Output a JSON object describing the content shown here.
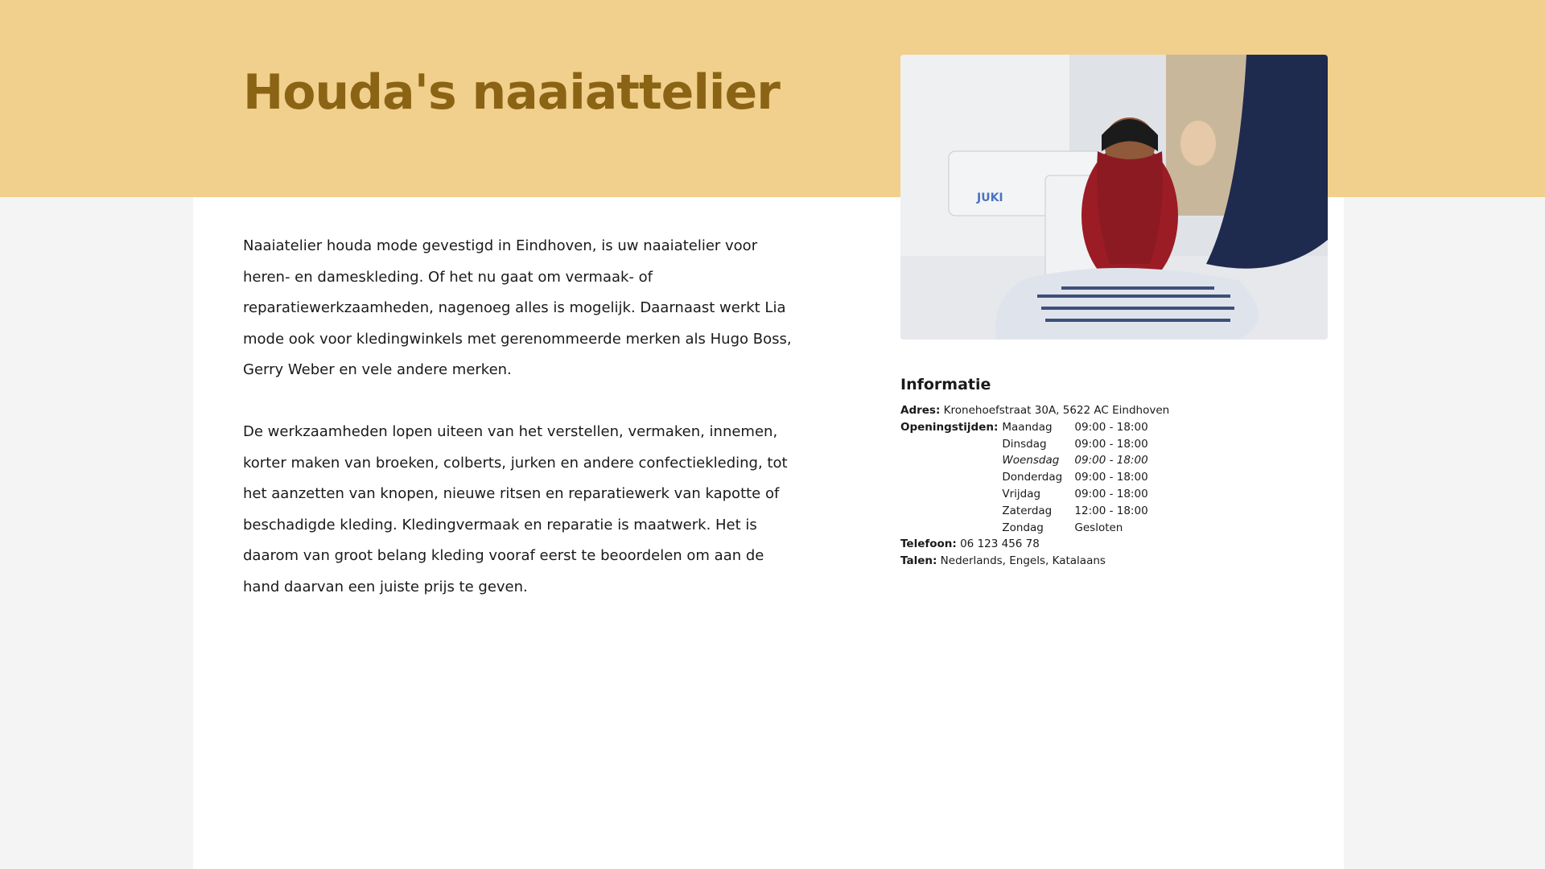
{
  "header": {
    "title": "Houda's naaiattelier",
    "band_color": "#f1cf8c",
    "title_color": "#8a6414"
  },
  "intro": {
    "paragraphs": [
      "Naaiatelier houda mode gevestigd in Eindhoven, is uw naaiatelier voor heren- en dameskleding. Of het nu gaat om vermaak- of reparatiewerkzaamheden, nagenoeg alles is mogelijk. Daarnaast werkt Lia mode ook voor kledingwinkels met gerenommeerde merken als Hugo Boss, Gerry Weber en vele andere merken.",
      "De werkzaamheden lopen uiteen van het verstellen, vermaken, innemen, korter maken van broeken, colberts, jurken en andere confectiekleding, tot het aanzetten van knopen, nieuwe ritsen en reparatiewerk van kapotte of beschadigde kleding. Kledingvermaak en reparatie is maatwerk. Het is daarom van groot belang kleding vooraf eerst te beoordelen om aan de hand daarvan een juiste prijs te geven."
    ]
  },
  "photo": {
    "machine_brand": "JUKI"
  },
  "info": {
    "heading": "Informatie",
    "address_label": "Adres:",
    "address": "Kronehoefstraat 30A, 5622 AC Eindhoven",
    "hours_label": "Openingstijden:",
    "hours": [
      {
        "day": "Maandag",
        "time": "09:00 - 18:00"
      },
      {
        "day": "Dinsdag",
        "time": "09:00 - 18:00"
      },
      {
        "day": "Woensdag",
        "time": "09:00 - 18:00"
      },
      {
        "day": "Donderdag",
        "time": "09:00 - 18:00"
      },
      {
        "day": "Vrijdag",
        "time": "09:00 - 18:00"
      },
      {
        "day": "Zaterdag",
        "time": "12:00 - 18:00"
      },
      {
        "day": "Zondag",
        "time": "Gesloten"
      }
    ],
    "phone_label": "Telefoon:",
    "phone": "06 123 456 78",
    "languages_label": "Talen:",
    "languages": "Nederlands, Engels, Katalaans"
  }
}
